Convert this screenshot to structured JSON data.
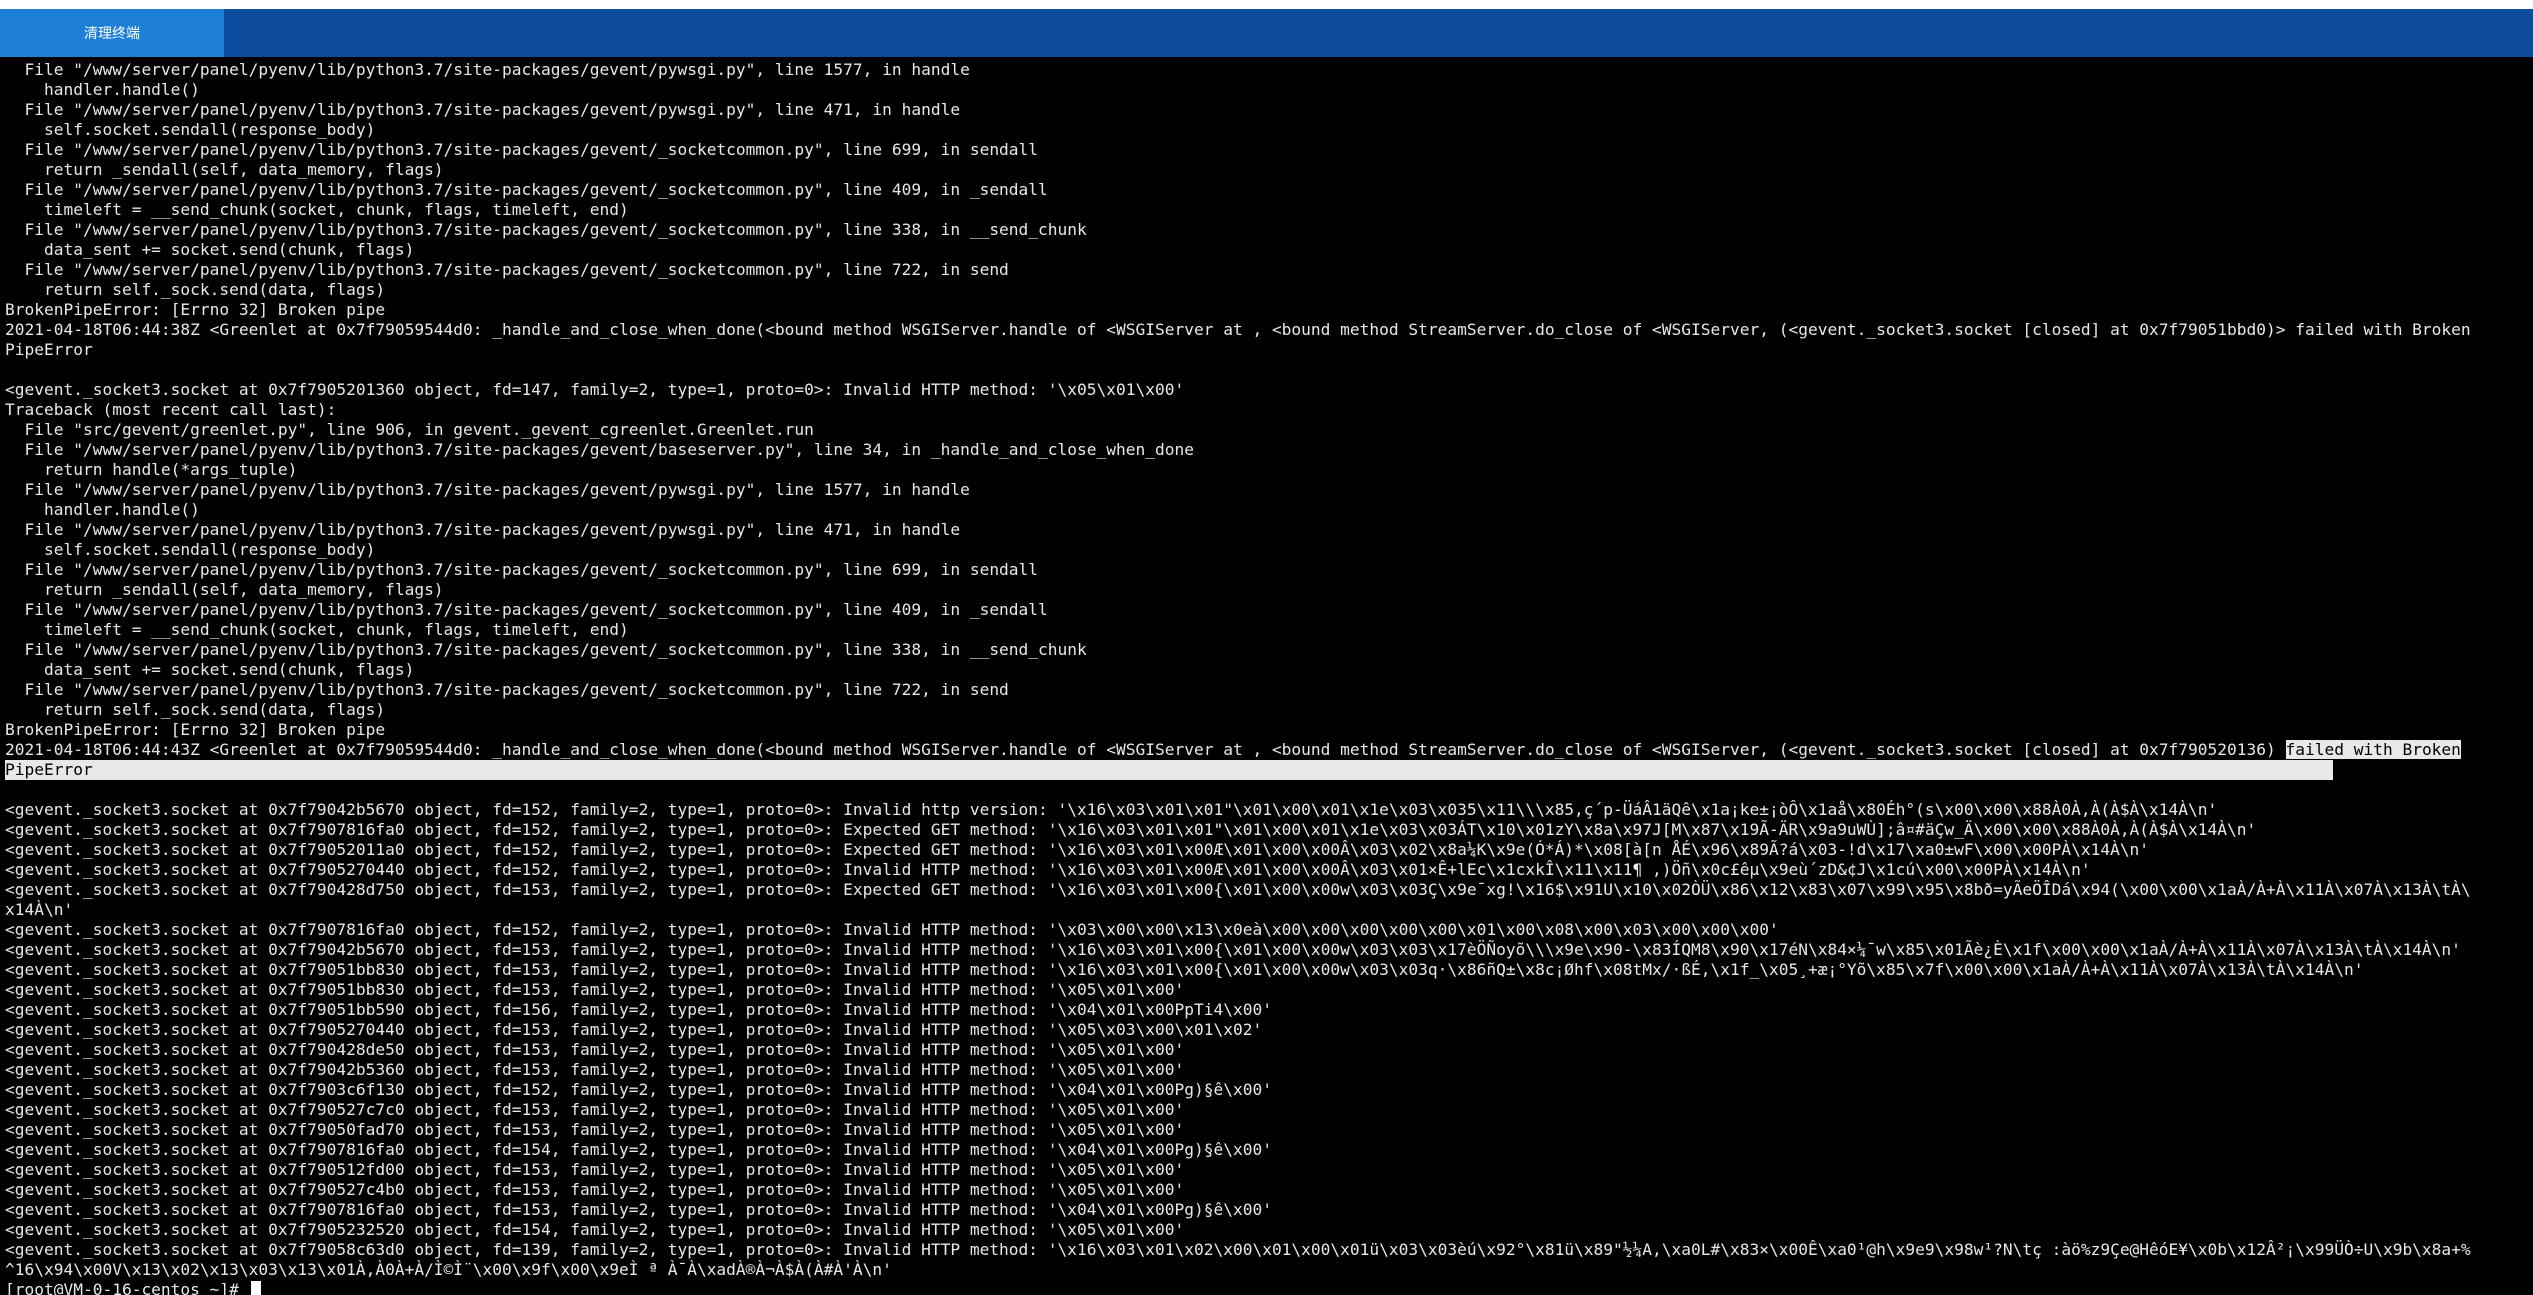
{
  "toolbar": {
    "clear_terminal_label": "清理终端"
  },
  "colors": {
    "tabbar": "#0d4b9c",
    "active_tab": "#1e7fd6",
    "terminal_bg": "#000000",
    "terminal_fg": "#e8e8e8"
  },
  "terminal": {
    "lines": [
      "  File \"/www/server/panel/pyenv/lib/python3.7/site-packages/gevent/pywsgi.py\", line 1577, in handle",
      "    handler.handle()",
      "  File \"/www/server/panel/pyenv/lib/python3.7/site-packages/gevent/pywsgi.py\", line 471, in handle",
      "    self.socket.sendall(response_body)",
      "  File \"/www/server/panel/pyenv/lib/python3.7/site-packages/gevent/_socketcommon.py\", line 699, in sendall",
      "    return _sendall(self, data_memory, flags)",
      "  File \"/www/server/panel/pyenv/lib/python3.7/site-packages/gevent/_socketcommon.py\", line 409, in _sendall",
      "    timeleft = __send_chunk(socket, chunk, flags, timeleft, end)",
      "  File \"/www/server/panel/pyenv/lib/python3.7/site-packages/gevent/_socketcommon.py\", line 338, in __send_chunk",
      "    data_sent += socket.send(chunk, flags)",
      "  File \"/www/server/panel/pyenv/lib/python3.7/site-packages/gevent/_socketcommon.py\", line 722, in send",
      "    return self._sock.send(data, flags)",
      "BrokenPipeError: [Errno 32] Broken pipe",
      "2021-04-18T06:44:38Z <Greenlet at 0x7f79059544d0: _handle_and_close_when_done(<bound method WSGIServer.handle of <WSGIServer at , <bound method StreamServer.do_close of <WSGIServer, (<gevent._socket3.socket [closed] at 0x7f79051bbd0)> failed with Broken",
      "PipeError",
      "",
      "<gevent._socket3.socket at 0x7f7905201360 object, fd=147, family=2, type=1, proto=0>: Invalid HTTP method: '\\x05\\x01\\x00'",
      "Traceback (most recent call last):",
      "  File \"src/gevent/greenlet.py\", line 906, in gevent._gevent_cgreenlet.Greenlet.run",
      "  File \"/www/server/panel/pyenv/lib/python3.7/site-packages/gevent/baseserver.py\", line 34, in _handle_and_close_when_done",
      "    return handle(*args_tuple)",
      "  File \"/www/server/panel/pyenv/lib/python3.7/site-packages/gevent/pywsgi.py\", line 1577, in handle",
      "    handler.handle()",
      "  File \"/www/server/panel/pyenv/lib/python3.7/site-packages/gevent/pywsgi.py\", line 471, in handle",
      "    self.socket.sendall(response_body)",
      "  File \"/www/server/panel/pyenv/lib/python3.7/site-packages/gevent/_socketcommon.py\", line 699, in sendall",
      "    return _sendall(self, data_memory, flags)",
      "  File \"/www/server/panel/pyenv/lib/python3.7/site-packages/gevent/_socketcommon.py\", line 409, in _sendall",
      "    timeleft = __send_chunk(socket, chunk, flags, timeleft, end)",
      "  File \"/www/server/panel/pyenv/lib/python3.7/site-packages/gevent/_socketcommon.py\", line 338, in __send_chunk",
      "    data_sent += socket.send(chunk, flags)",
      "  File \"/www/server/panel/pyenv/lib/python3.7/site-packages/gevent/_socketcommon.py\", line 722, in send",
      "    return self._sock.send(data, flags)",
      "BrokenPipeError: [Errno 32] Broken pipe"
    ],
    "highlight_line": {
      "prefix": "2021-04-18T06:44:43Z <Greenlet at 0x7f79059544d0: _handle_and_close_when_done(<bound method WSGIServer.handle of <WSGIServer at , <bound method StreamServer.do_close of <WSGIServer, (<gevent._socket3.socket [closed] at 0x7f790520136) ",
      "highlighted": "failed with Broken"
    },
    "highlight_continuation": "PipeError",
    "lines_after": [
      "",
      "<gevent._socket3.socket at 0x7f79042b5670 object, fd=152, family=2, type=1, proto=0>: Invalid http version: '\\x16\\x03\\x01\\x01\"\\x01\\x00\\x01\\x1e\\x03\\x035\\x11\\\\\\x85,ç´p-ÜáÂ1äQê\\x1a¡ke±¡òÔ\\x1aå\\x80Éh°(s\\x00\\x00\\x88À0À,À(À$À\\x14À\\n'",
      "<gevent._socket3.socket at 0x7f7907816fa0 object, fd=152, family=2, type=1, proto=0>: Expected GET method: '\\x16\\x03\\x01\\x01\"\\x01\\x00\\x01\\x1e\\x03\\x03ÁT\\x10\\x01zY\\x8a\\x97J[M\\x87\\x19Ã-ÄR\\x9a9uWÙ];â¤#äÇw_Ä\\x00\\x00\\x88À0À,À(À$À\\x14À\\n'",
      "<gevent._socket3.socket at 0x7f79052011a0 object, fd=152, family=2, type=1, proto=0>: Expected GET method: '\\x16\\x03\\x01\\x00Æ\\x01\\x00\\x00Â\\x03\\x02\\x8a¼K\\x9e(Ó*Á)*\\x08[à[n ÅÉ\\x96\\x89Ã?á\\x03-!d\\x17\\xa0±wF\\x00\\x00PÀ\\x14À\\n'",
      "<gevent._socket3.socket at 0x7f7905270440 object, fd=152, family=2, type=1, proto=0>: Invalid HTTP method: '\\x16\\x03\\x01\\x00Æ\\x01\\x00\\x00Â\\x03\\x01×Ê+lEc\\x1cxkÎ\\x11\\x11¶ ,)Öñ\\x0c£êµ\\x9eù´zD&¢J\\x1cú\\x00\\x00PÀ\\x14À\\n'",
      "<gevent._socket3.socket at 0x7f790428d750 object, fd=153, family=2, type=1, proto=0>: Expected GET method: '\\x16\\x03\\x01\\x00{\\x01\\x00\\x00w\\x03\\x03Ç\\x9e¯xg!\\x16$\\x91U\\x10\\x02ÒÜ\\x86\\x12\\x83\\x07\\x99\\x95\\x8bð=yÃeÖÎDá\\x94(\\x00\\x00\\x1aÀ/À+À\\x11À\\x07À\\x13À\\tÀ\\",
      "x14À\\n'",
      "<gevent._socket3.socket at 0x7f7907816fa0 object, fd=152, family=2, type=1, proto=0>: Invalid HTTP method: '\\x03\\x00\\x00\\x13\\x0eà\\x00\\x00\\x00\\x00\\x00\\x01\\x00\\x08\\x00\\x03\\x00\\x00\\x00'",
      "<gevent._socket3.socket at 0x7f79042b5670 object, fd=153, family=2, type=1, proto=0>: Invalid HTTP method: '\\x16\\x03\\x01\\x00{\\x01\\x00\\x00w\\x03\\x03\\x17èÖÑoyõ\\\\\\x9e\\x90-\\x83ÍQM8\\x90\\x17éN\\x84×¼¯w\\x85\\x01Ãè¿È\\x1f\\x00\\x00\\x1aÀ/À+À\\x11À\\x07À\\x13À\\tÀ\\x14À\\n'",
      "<gevent._socket3.socket at 0x7f79051bb830 object, fd=153, family=2, type=1, proto=0>: Invalid HTTP method: '\\x16\\x03\\x01\\x00{\\x01\\x00\\x00w\\x03\\x03q·\\x86ñQ±\\x8c¡Øhf\\x08tMx/·ßÉ,\\x1f_\\x05¸+æ¡°Yõ\\x85\\x7f\\x00\\x00\\x1aÀ/À+À\\x11À\\x07À\\x13À\\tÀ\\x14À\\n'",
      "<gevent._socket3.socket at 0x7f79051bb830 object, fd=153, family=2, type=1, proto=0>: Invalid HTTP method: '\\x05\\x01\\x00'",
      "<gevent._socket3.socket at 0x7f79051bb590 object, fd=156, family=2, type=1, proto=0>: Invalid HTTP method: '\\x04\\x01\\x00PpTi4\\x00'",
      "<gevent._socket3.socket at 0x7f7905270440 object, fd=153, family=2, type=1, proto=0>: Invalid HTTP method: '\\x05\\x03\\x00\\x01\\x02'",
      "<gevent._socket3.socket at 0x7f790428de50 object, fd=153, family=2, type=1, proto=0>: Invalid HTTP method: '\\x05\\x01\\x00'",
      "<gevent._socket3.socket at 0x7f79042b5360 object, fd=153, family=2, type=1, proto=0>: Invalid HTTP method: '\\x05\\x01\\x00'",
      "<gevent._socket3.socket at 0x7f7903c6f130 object, fd=152, family=2, type=1, proto=0>: Invalid HTTP method: '\\x04\\x01\\x00Pg)§ê\\x00'",
      "<gevent._socket3.socket at 0x7f790527c7c0 object, fd=153, family=2, type=1, proto=0>: Invalid HTTP method: '\\x05\\x01\\x00'",
      "<gevent._socket3.socket at 0x7f79050fad70 object, fd=153, family=2, type=1, proto=0>: Invalid HTTP method: '\\x05\\x01\\x00'",
      "<gevent._socket3.socket at 0x7f7907816fa0 object, fd=154, family=2, type=1, proto=0>: Invalid HTTP method: '\\x04\\x01\\x00Pg)§ê\\x00'",
      "<gevent._socket3.socket at 0x7f790512fd00 object, fd=153, family=2, type=1, proto=0>: Invalid HTTP method: '\\x05\\x01\\x00'",
      "<gevent._socket3.socket at 0x7f790527c4b0 object, fd=153, family=2, type=1, proto=0>: Invalid HTTP method: '\\x05\\x01\\x00'",
      "<gevent._socket3.socket at 0x7f7907816fa0 object, fd=153, family=2, type=1, proto=0>: Invalid HTTP method: '\\x04\\x01\\x00Pg)§ê\\x00'",
      "<gevent._socket3.socket at 0x7f7905232520 object, fd=154, family=2, type=1, proto=0>: Invalid HTTP method: '\\x05\\x01\\x00'",
      "<gevent._socket3.socket at 0x7f79058c63d0 object, fd=139, family=2, type=1, proto=0>: Invalid HTTP method: '\\x16\\x03\\x01\\x02\\x00\\x01\\x00\\x01ü\\x03\\x03èú\\x92°\\x81ü\\x89\"½¼A,\\xa0L#\\x83×\\x00Ê\\xa0¹@h\\x9e9\\x98w¹?N\\tç :àö%z9Çe@HêóE¥\\x0b\\x12Â²¡\\x99ÜÒ÷U\\x9b\\x8a+%",
      "^16\\x94\\x00V\\x13\\x02\\x13\\x03\\x13\\x01À,À0À+À/Ì©Ì¨\\x00\\x9f\\x00\\x9eÌ ª À¯À\\xadÀ®À¬À$À(À#À'À\\n'"
    ],
    "prompt": "[root@VM-0-16-centos ~]# "
  }
}
